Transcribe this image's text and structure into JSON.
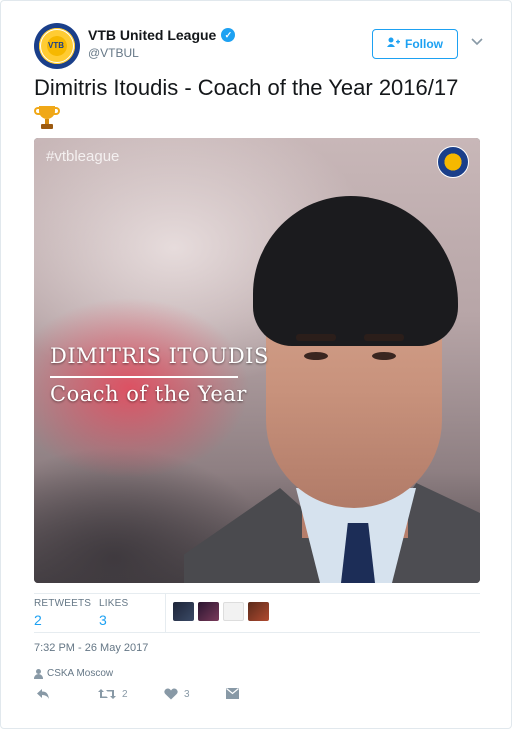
{
  "account": {
    "display_name": "VTB United League",
    "handle": "@VTBUL",
    "avatar_text": "VTB",
    "verified": true
  },
  "follow_button": {
    "label": "Follow"
  },
  "tweet": {
    "text": "Dimitris Itoudis - Coach of the Year 2016/17",
    "emoji": "trophy"
  },
  "media": {
    "hashtag": "#vtbleague",
    "overlay_name": "DIMITRIS ITOUDIS",
    "overlay_title": "Coach of the Year"
  },
  "stats": {
    "retweets_label": "RETWEETS",
    "retweets_value": "2",
    "likes_label": "LIKES",
    "likes_value": "3"
  },
  "retweeter_avatars": [
    "#3b4a66",
    "#5b2d4a",
    "#e8e8e8",
    "#8a3a2a"
  ],
  "timestamp": "7:32 PM - 26 May 2017",
  "location": "CSKA Moscow",
  "actions": {
    "reply": {
      "icon": "reply-icon"
    },
    "retweet": {
      "icon": "retweet-icon",
      "count": "2"
    },
    "like": {
      "icon": "heart-icon",
      "count": "3"
    },
    "message": {
      "icon": "envelope-icon"
    }
  },
  "colors": {
    "accent": "#1da1f2",
    "muted": "#657786",
    "border": "#e1e8ed"
  }
}
